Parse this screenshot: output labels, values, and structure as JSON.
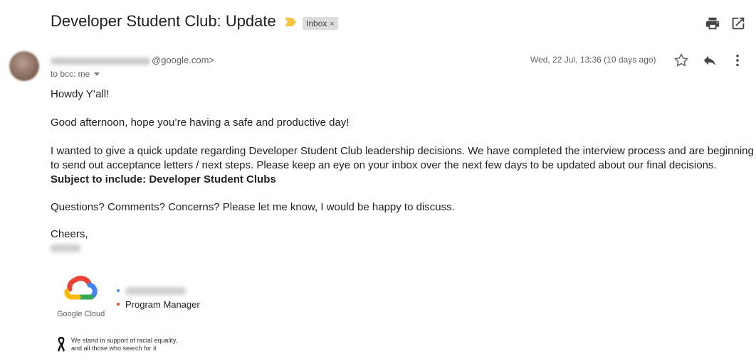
{
  "email": {
    "subject": "Developer Student Club: Update",
    "label": "Inbox",
    "label_remove": "×",
    "sender_domain": "@google.com>",
    "recipients": "to bcc: me",
    "date": "Wed, 22 Jul, 13:36 (10 days ago)"
  },
  "body": {
    "greeting": "Howdy Y’all!",
    "line1": "Good afternoon, hope you’re having a safe and productive day!",
    "line2a": "I wanted to give a quick update regarding Developer Student Club leadership decisions. We have completed the interview process and are beginning",
    "line2b": "to send out acceptance letters / next steps. Please keep an eye on your inbox over the next few days to be updated about our final decisions.",
    "subject_line": "Subject to include: Developer Student Clubs",
    "questions": "Questions? Comments? Concerns? Please let me know, I would be happy to discuss.",
    "closing": "Cheers,"
  },
  "signature": {
    "company": "Google Cloud",
    "role": "Program Manager",
    "equality_line1": "We stand in support of racial equality,",
    "equality_line2": "and all those who search for it"
  },
  "icons": {
    "important": "important-marker-icon",
    "print": "print-icon",
    "popout": "open-in-new-window-icon",
    "star": "star-icon",
    "reply": "reply-icon",
    "more": "more-vertical-icon",
    "ribbon": "black-ribbon-icon"
  },
  "colors": {
    "important_marker": "#f6c342",
    "google_blue": "#4285f4",
    "google_red": "#ea4335",
    "google_yellow": "#fbbc05",
    "google_green": "#34a853"
  }
}
